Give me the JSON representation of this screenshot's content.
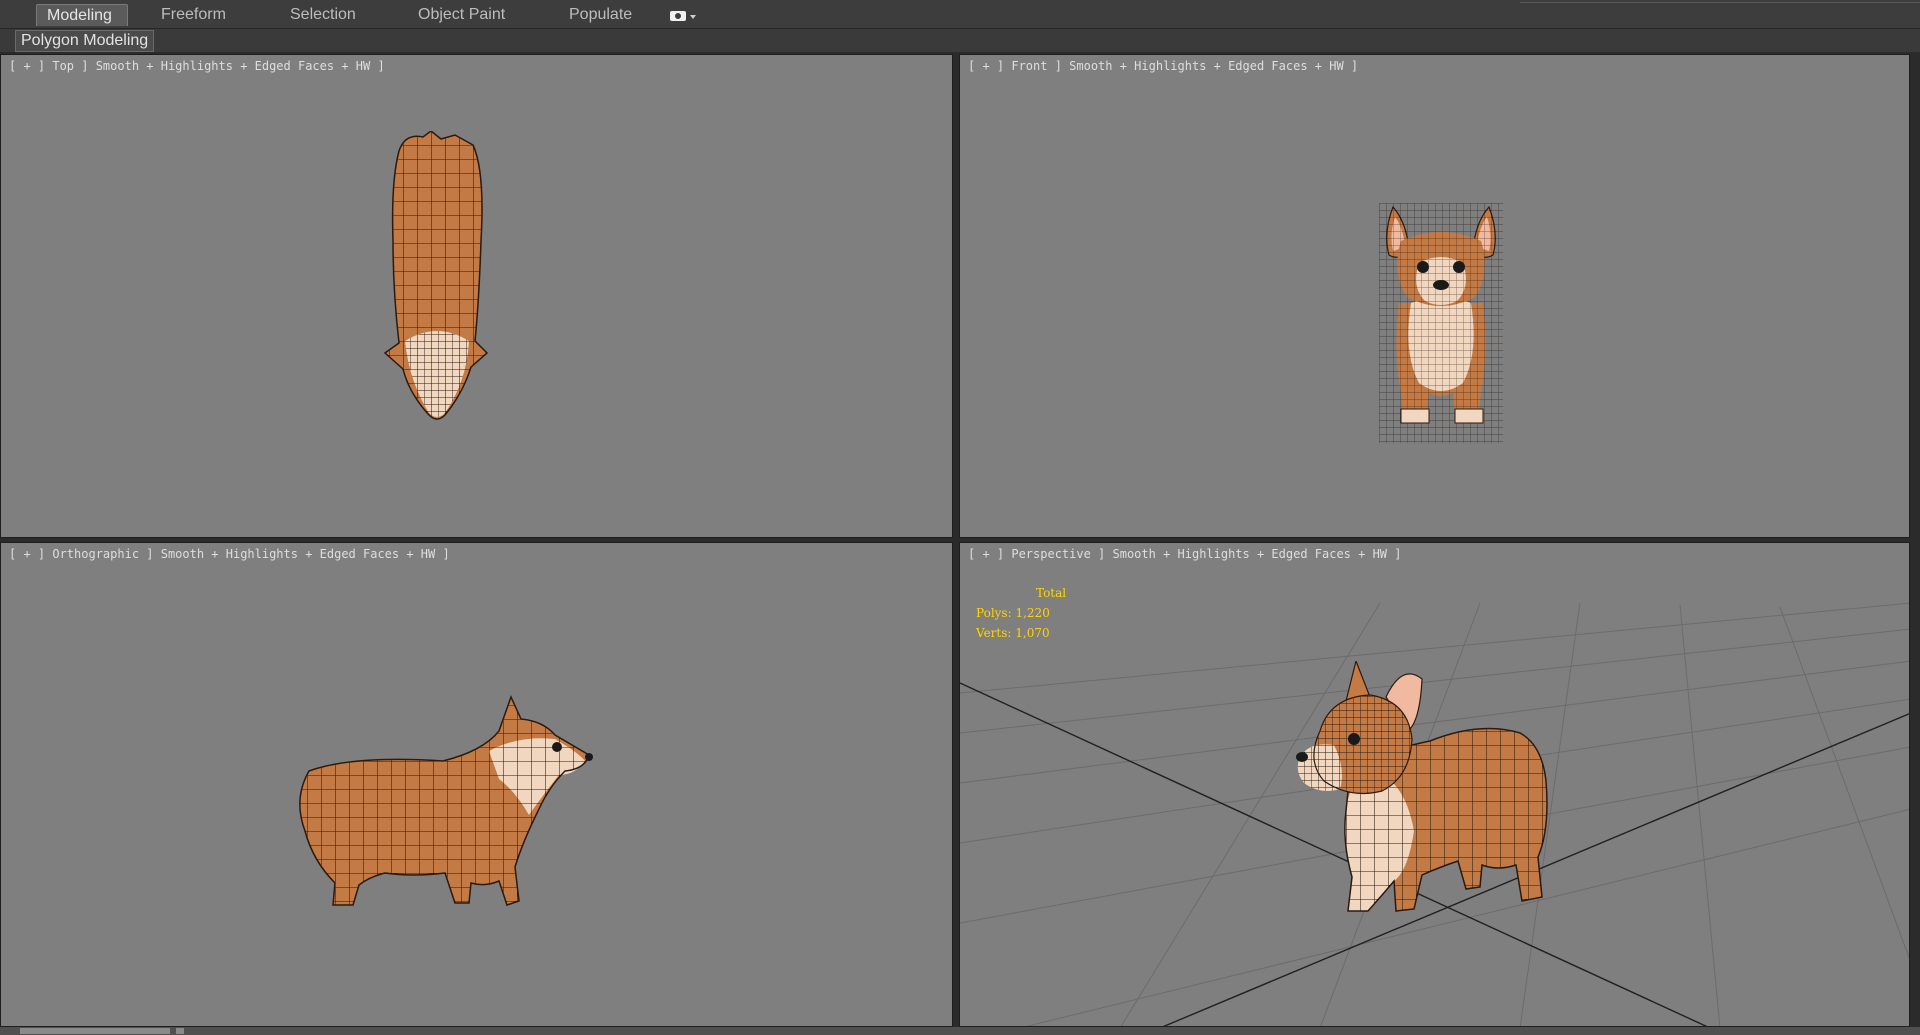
{
  "ribbon": {
    "tabs": [
      {
        "label": "Modeling",
        "active": true
      },
      {
        "label": "Freeform",
        "active": false
      },
      {
        "label": "Selection",
        "active": false
      },
      {
        "label": "Object Paint",
        "active": false
      },
      {
        "label": "Populate",
        "active": false
      }
    ],
    "menu_icon": "eye-dropdown-icon",
    "panel_label": "Polygon Modeling"
  },
  "viewports": [
    {
      "id": "top",
      "label": "[ + ] Top ] Smooth + Highlights + Edged Faces + HW ]",
      "view": "Top"
    },
    {
      "id": "front",
      "label": "[ + ] Front ] Smooth + Highlights + Edged Faces + HW ]",
      "view": "Front"
    },
    {
      "id": "ortho",
      "label": "[ + ] Orthographic ] Smooth + Highlights + Edged Faces + HW ]",
      "view": "Orthographic"
    },
    {
      "id": "persp",
      "label": "[ + ] Perspective ] Smooth + Highlights + Edged Faces + HW ]",
      "view": "Perspective"
    }
  ],
  "stats": {
    "title": "Total",
    "polys_label": "Polys:",
    "polys": "1,220",
    "verts_label": "Verts:",
    "verts": "1,070"
  },
  "colors": {
    "viewport_bg": "#7f7f7f",
    "stats_text": "#ffd400",
    "fur": "#c8834f",
    "fur_light": "#f1d6c0",
    "wire": "#2a1a10"
  }
}
